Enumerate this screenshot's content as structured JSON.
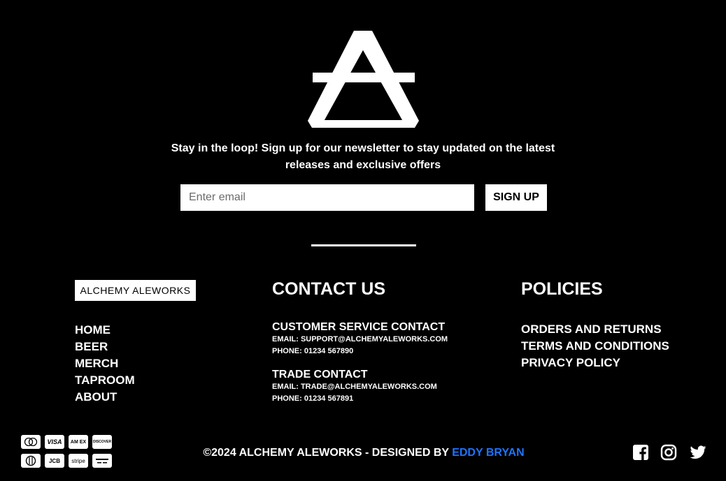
{
  "brand": {
    "name": "ALCHEMY ALEWORKS",
    "logo_icon": "air-alchemy-triangle-icon"
  },
  "newsletter": {
    "tagline": "Stay in the loop! Sign up for our newsletter to stay updated on the latest releases and exclusive offers",
    "email_placeholder": "Enter email",
    "email_value": "",
    "signup_label": "SIGN UP"
  },
  "nav": {
    "items": [
      {
        "label": "HOME"
      },
      {
        "label": "BEER"
      },
      {
        "label": "MERCH"
      },
      {
        "label": "TAPROOM"
      },
      {
        "label": "ABOUT"
      }
    ]
  },
  "contact": {
    "heading": "CONTACT US",
    "customer_service": {
      "title": "CUSTOMER SERVICE CONTACT",
      "email": "EMAIL: SUPPORT@ALCHEMYALEWORKS.COM",
      "phone": "PHONE: 01234 567890"
    },
    "trade": {
      "title": "TRADE CONTACT",
      "email": "EMAIL: TRADE@ALCHEMYALEWORKS.COM",
      "phone": "PHONE: 01234 567891"
    }
  },
  "policies": {
    "heading": "POLICIES",
    "items": [
      {
        "label": "ORDERS AND RETURNS"
      },
      {
        "label": "TERMS AND CONDITIONS"
      },
      {
        "label": "PRIVACY POLICY"
      }
    ]
  },
  "footer": {
    "copyright_prefix": "©2024 ALCHEMY ALEWORKS - DESIGNED BY ",
    "designer_link": "EDDY BRYAN",
    "link_color": "#1e74ff"
  },
  "payments": {
    "methods": [
      {
        "icon": "mastercard-icon",
        "label": ""
      },
      {
        "icon": "visa-icon",
        "label": "VISA"
      },
      {
        "icon": "amex-icon",
        "label": "AM EX"
      },
      {
        "icon": "discover-icon",
        "label": "DISCOVER"
      },
      {
        "icon": "diners-club-icon",
        "label": ""
      },
      {
        "icon": "jcb-icon",
        "label": "JCB"
      },
      {
        "icon": "stripe-icon",
        "label": "stripe"
      },
      {
        "icon": "generic-card-icon",
        "label": ""
      }
    ]
  },
  "social": {
    "icons": [
      "facebook-icon",
      "instagram-icon",
      "twitter-icon"
    ]
  }
}
